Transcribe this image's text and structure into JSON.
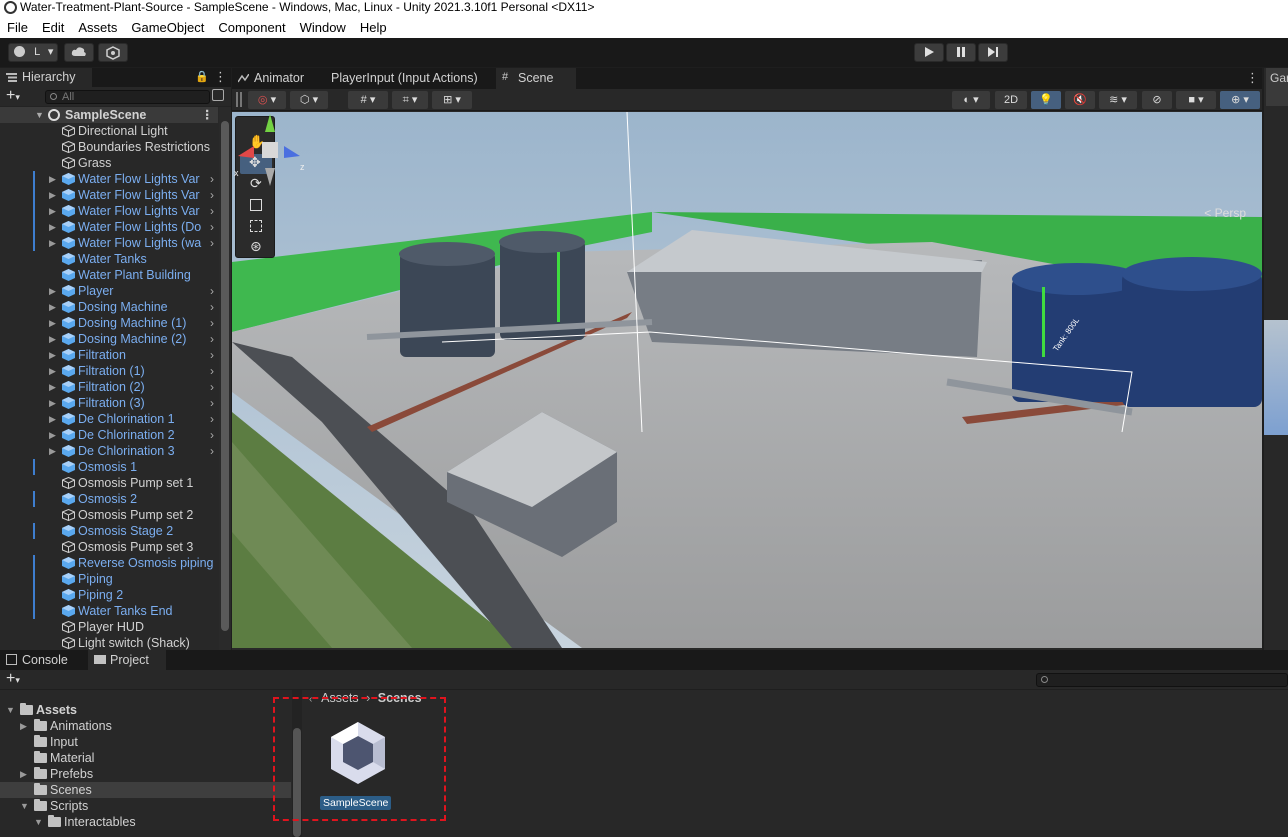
{
  "window": {
    "title": "Water-Treatment-Plant-Source - SampleScene - Windows, Mac, Linux - Unity 2021.3.10f1 Personal <DX11>"
  },
  "menu": [
    "File",
    "Edit",
    "Assets",
    "GameObject",
    "Component",
    "Window",
    "Help"
  ],
  "toolbar": {
    "account_label": "L"
  },
  "hierarchy": {
    "tab": "Hierarchy",
    "search_placeholder": "All",
    "scene_name": "SampleScene",
    "items": [
      {
        "label": "Directional Light",
        "prefab": false,
        "expand": false
      },
      {
        "label": "Boundaries Restrictions",
        "prefab": false,
        "expand": false
      },
      {
        "label": "Grass",
        "prefab": false,
        "expand": false
      },
      {
        "label": "Water Flow Lights Var",
        "prefab": true,
        "expand": true
      },
      {
        "label": "Water Flow Lights Var",
        "prefab": true,
        "expand": true
      },
      {
        "label": "Water Flow Lights Var",
        "prefab": true,
        "expand": true
      },
      {
        "label": "Water Flow Lights (Do",
        "prefab": true,
        "expand": true
      },
      {
        "label": "Water Flow Lights (wa",
        "prefab": true,
        "expand": true
      },
      {
        "label": "Water Tanks",
        "prefab": true,
        "expand": false
      },
      {
        "label": "Water Plant Building",
        "prefab": true,
        "expand": false
      },
      {
        "label": "Player",
        "prefab": true,
        "expand": true
      },
      {
        "label": "Dosing Machine",
        "prefab": true,
        "expand": true
      },
      {
        "label": "Dosing Machine (1)",
        "prefab": true,
        "expand": true
      },
      {
        "label": "Dosing Machine (2)",
        "prefab": true,
        "expand": true
      },
      {
        "label": "Filtration",
        "prefab": true,
        "expand": true
      },
      {
        "label": "Filtration (1)",
        "prefab": true,
        "expand": true
      },
      {
        "label": "Filtration (2)",
        "prefab": true,
        "expand": true
      },
      {
        "label": "Filtration (3)",
        "prefab": true,
        "expand": true
      },
      {
        "label": "De Chlorination 1",
        "prefab": true,
        "expand": true
      },
      {
        "label": "De Chlorination 2",
        "prefab": true,
        "expand": true
      },
      {
        "label": "De Chlorination 3",
        "prefab": true,
        "expand": true
      },
      {
        "label": "Osmosis 1",
        "prefab": true,
        "expand": false
      },
      {
        "label": "Osmosis Pump set 1",
        "prefab": false,
        "expand": false
      },
      {
        "label": "Osmosis 2",
        "prefab": true,
        "expand": false
      },
      {
        "label": "Osmosis Pump set 2",
        "prefab": false,
        "expand": false
      },
      {
        "label": "Osmosis Stage 2",
        "prefab": true,
        "expand": false
      },
      {
        "label": "Osmosis Pump set 3",
        "prefab": false,
        "expand": false
      },
      {
        "label": "Reverse Osmosis piping",
        "prefab": true,
        "expand": false
      },
      {
        "label": "Piping",
        "prefab": true,
        "expand": false
      },
      {
        "label": "Piping 2",
        "prefab": true,
        "expand": false
      },
      {
        "label": "Water Tanks End",
        "prefab": true,
        "expand": false
      },
      {
        "label": "Player HUD",
        "prefab": false,
        "expand": false
      },
      {
        "label": "Light switch (Shack)",
        "prefab": false,
        "expand": false
      }
    ]
  },
  "scene_tabs": [
    "Animator",
    "PlayerInput (Input Actions)",
    "Scene"
  ],
  "scene": {
    "btn_2d": "2D",
    "persp_label": "Persp",
    "tank_label": "Name\nTank: 800L"
  },
  "right_tab": "Gar",
  "bottom_tabs": [
    "Console",
    "Project"
  ],
  "project": {
    "tree": [
      {
        "label": "Assets",
        "depth": 0,
        "open": true,
        "bold": true
      },
      {
        "label": "Animations",
        "depth": 1,
        "arrow": true
      },
      {
        "label": "Input",
        "depth": 1,
        "arrow": false
      },
      {
        "label": "Material",
        "depth": 1,
        "arrow": false
      },
      {
        "label": "Prefebs",
        "depth": 1,
        "arrow": true
      },
      {
        "label": "Scenes",
        "depth": 1,
        "arrow": false,
        "selected": true
      },
      {
        "label": "Scripts",
        "depth": 1,
        "open": true
      },
      {
        "label": "Interactables",
        "depth": 2,
        "open": true
      }
    ],
    "breadcrumb": [
      "Assets",
      "Scenes"
    ],
    "asset_name": "SampleScene"
  }
}
